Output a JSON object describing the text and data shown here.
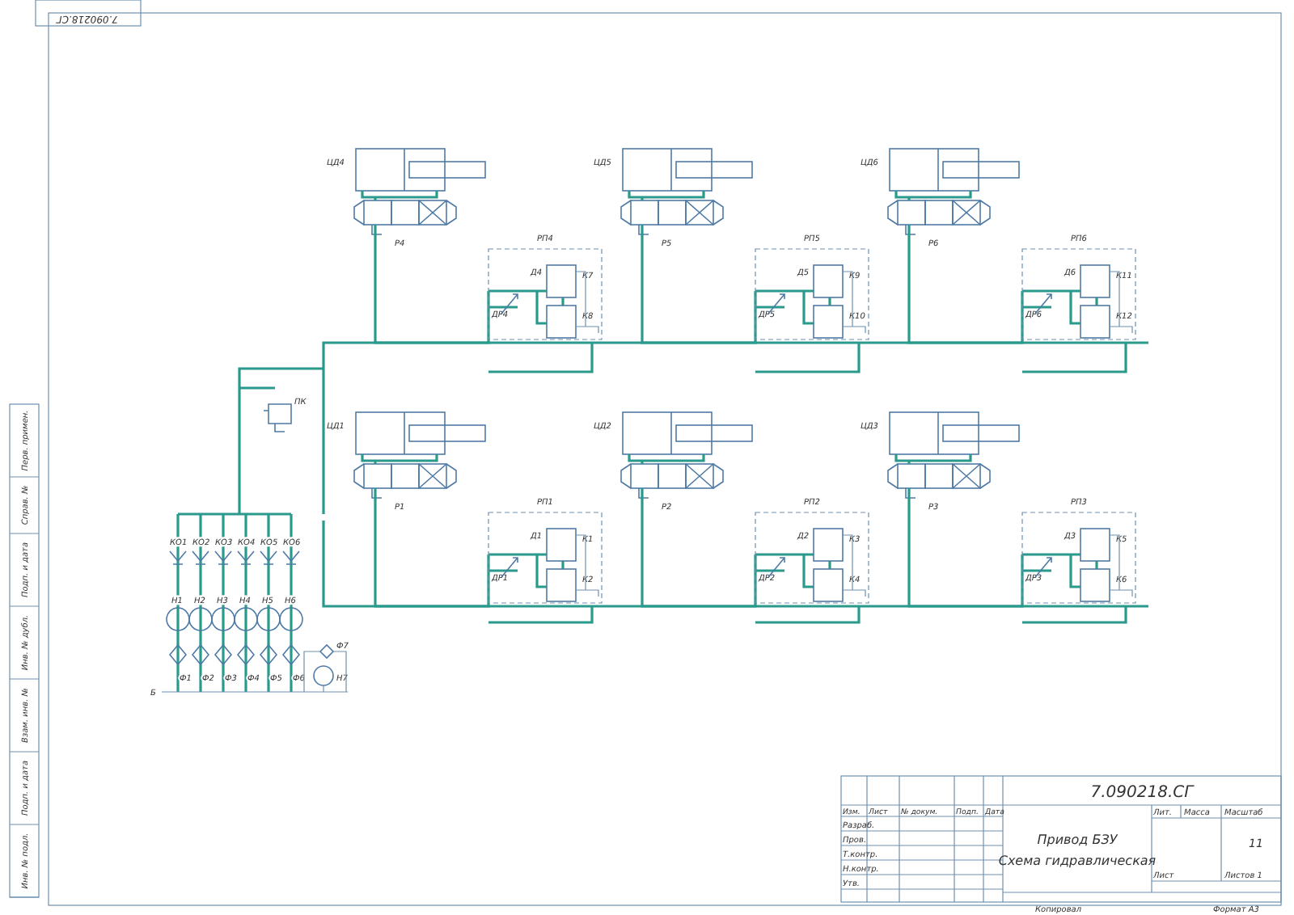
{
  "stamp": {
    "code": "7.090218.СГ"
  },
  "side_strip": [
    "Перв. примен.",
    "Справ. №",
    "Подп. и дата",
    "Инв. № дубл.",
    "Взам. инв. №",
    "Подп. и дата",
    "Инв. № подл."
  ],
  "units": [
    {
      "cylinder": "ЦД4",
      "valve": "Р4",
      "block": "РП4",
      "throttle": "Д4",
      "regulator": "ДР4",
      "relay_top": "К7",
      "relay_bottom": "К8"
    },
    {
      "cylinder": "ЦД5",
      "valve": "Р5",
      "block": "РП5",
      "throttle": "Д5",
      "regulator": "ДР5",
      "relay_top": "К9",
      "relay_bottom": "К10"
    },
    {
      "cylinder": "ЦД6",
      "valve": "Р6",
      "block": "РП6",
      "throttle": "Д6",
      "regulator": "ДР6",
      "relay_top": "К11",
      "relay_bottom": "К12"
    },
    {
      "cylinder": "ЦД1",
      "valve": "Р1",
      "block": "РП1",
      "throttle": "Д1",
      "regulator": "ДР1",
      "relay_top": "К1",
      "relay_bottom": "К2"
    },
    {
      "cylinder": "ЦД2",
      "valve": "Р2",
      "block": "РП2",
      "throttle": "Д2",
      "regulator": "ДР2",
      "relay_top": "К3",
      "relay_bottom": "К4"
    },
    {
      "cylinder": "ЦД3",
      "valve": "Р3",
      "block": "РП3",
      "throttle": "Д3",
      "regulator": "ДР3",
      "relay_top": "К5",
      "relay_bottom": "К6"
    }
  ],
  "supply": {
    "relief_valve": "ПК",
    "tank": "Б",
    "aux_pump": "Н7",
    "aux_filter": "Ф7",
    "lines": [
      {
        "check_valve": "КО1",
        "pump": "Н1",
        "filter": "Ф1"
      },
      {
        "check_valve": "КО2",
        "pump": "Н2",
        "filter": "Ф2"
      },
      {
        "check_valve": "КО3",
        "pump": "Н3",
        "filter": "Ф3"
      },
      {
        "check_valve": "КО4",
        "pump": "Н4",
        "filter": "Ф4"
      },
      {
        "check_valve": "КО5",
        "pump": "Н5",
        "filter": "Ф5"
      },
      {
        "check_valve": "КО6",
        "pump": "Н6",
        "filter": "Ф6"
      }
    ]
  },
  "title_block": {
    "code": "7.090218.СГ",
    "name_lines": [
      "Привод БЗУ",
      "Схема гидравлическая"
    ],
    "columns": [
      "Изм.",
      "Лист",
      "№ докум.",
      "Подп.",
      "Дата"
    ],
    "roles": [
      "Разраб.",
      "Пров.",
      "Т.контр.",
      "Н.контр.",
      "Утв."
    ],
    "lit": "Лит.",
    "mass": "Масса",
    "scale": "Масштаб",
    "scale_value": "11",
    "sheet": "Лист",
    "sheets": "Листов 1",
    "copied": "Копировал",
    "format": "Формат А3"
  }
}
